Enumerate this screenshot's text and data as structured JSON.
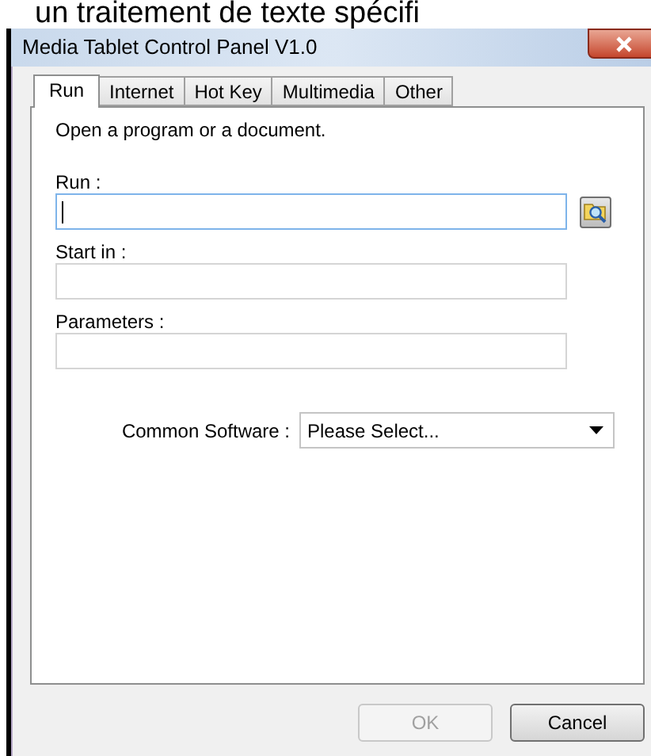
{
  "background_text": "un traitement de texte spécifi",
  "window": {
    "title": "Media Tablet Control Panel V1.0"
  },
  "tabs": [
    {
      "label": "Run",
      "selected": true
    },
    {
      "label": "Internet",
      "selected": false
    },
    {
      "label": "Hot Key",
      "selected": false
    },
    {
      "label": "Multimedia",
      "selected": false
    },
    {
      "label": "Other",
      "selected": false
    }
  ],
  "panel": {
    "instruction": "Open a program or a document.",
    "fields": [
      {
        "label": "Run :",
        "focused": true,
        "browse": true
      },
      {
        "label": "Start in :",
        "focused": false,
        "browse": false
      },
      {
        "label": "Parameters :",
        "focused": false,
        "browse": false
      }
    ],
    "common_software": {
      "label": "Common Software :",
      "value": "Please Select..."
    }
  },
  "buttons": [
    {
      "label": "OK",
      "disabled": true
    },
    {
      "label": "Cancel",
      "disabled": false
    }
  ]
}
